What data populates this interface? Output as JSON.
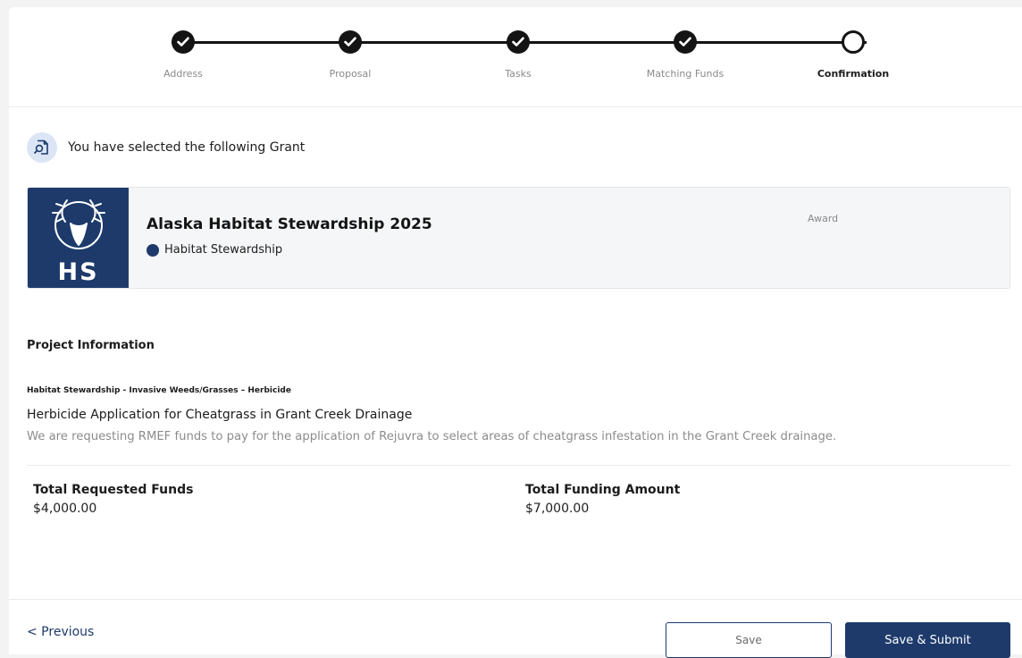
{
  "stepper": {
    "steps": [
      {
        "label": "Address",
        "state": "done"
      },
      {
        "label": "Proposal",
        "state": "done"
      },
      {
        "label": "Tasks",
        "state": "done"
      },
      {
        "label": "Matching Funds",
        "state": "done"
      },
      {
        "label": "Confirmation",
        "state": "current"
      }
    ]
  },
  "selection": {
    "text": "You have selected the following Grant",
    "icon": "document-search-icon"
  },
  "grant": {
    "title": "Alaska Habitat Stewardship 2025",
    "category": "Habitat Stewardship",
    "award_label": "Award",
    "logo_text": "HS",
    "logo_icon": "elk-head-icon",
    "brand_color": "#1d3a6b"
  },
  "project": {
    "heading": "Project Information",
    "category": "Habitat Stewardship - Invasive Weeds/Grasses – Herbicide",
    "title": "Herbicide Application for Cheatgrass in Grant Creek Drainage",
    "description": "We are requesting RMEF funds to pay for the application of Rejuvra to select areas of cheatgrass infestation in the Grant Creek drainage.",
    "requested_label": "Total Requested Funds",
    "requested_value": "$4,000.00",
    "funding_label": "Total Funding Amount",
    "funding_value": "$7,000.00"
  },
  "footer": {
    "previous_label": "< Previous",
    "save_label": "Save",
    "submit_label": "Save & Submit"
  }
}
